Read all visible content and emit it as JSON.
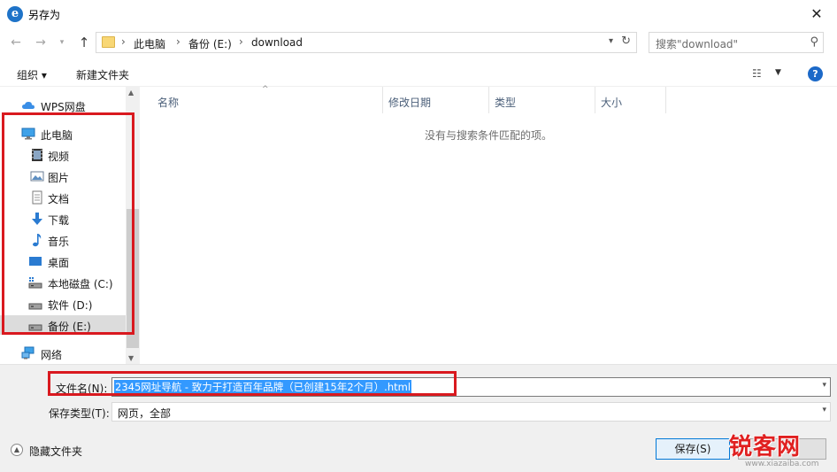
{
  "window": {
    "app_icon": "ie-e-icon",
    "title": "另存为",
    "close_label": "✕"
  },
  "address": {
    "breadcrumbs": [
      "此电脑",
      "备份 (E:)",
      "download"
    ],
    "search_placeholder": "搜索\"download\""
  },
  "toolbar": {
    "organize_label": "组织 ▾",
    "new_folder_label": "新建文件夹"
  },
  "nav": {
    "items": [
      {
        "label": "WPS网盘",
        "icon": "cloud-icon"
      },
      {
        "label": "此电脑",
        "icon": "computer-icon"
      },
      {
        "label": "视频",
        "icon": "video-icon"
      },
      {
        "label": "图片",
        "icon": "picture-icon"
      },
      {
        "label": "文档",
        "icon": "document-icon"
      },
      {
        "label": "下载",
        "icon": "download-icon"
      },
      {
        "label": "音乐",
        "icon": "music-icon"
      },
      {
        "label": "桌面",
        "icon": "desktop-icon"
      },
      {
        "label": "本地磁盘 (C:)",
        "icon": "system-drive-icon"
      },
      {
        "label": "软件 (D:)",
        "icon": "drive-icon"
      },
      {
        "label": "备份 (E:)",
        "icon": "drive-icon",
        "selected": true
      },
      {
        "label": "网络",
        "icon": "network-icon"
      }
    ]
  },
  "content": {
    "columns": [
      "名称",
      "修改日期",
      "类型",
      "大小"
    ],
    "empty_message": "没有与搜索条件匹配的项。"
  },
  "form": {
    "filename_label": "文件名(N):",
    "filename_value": "2345网址导航 - 致力于打造百年品牌（已创建15年2个月）.html",
    "filetype_label": "保存类型(T):",
    "filetype_value": "网页，全部",
    "hide_folders_label": "隐藏文件夹",
    "save_label": "保存(S)",
    "cancel_label": ""
  },
  "watermark": {
    "text": "锐客网",
    "url": "www.xiazaiba.com"
  },
  "colors": {
    "accent": "#0078d7",
    "highlight": "#d9191f",
    "selection": "#3399ff"
  }
}
